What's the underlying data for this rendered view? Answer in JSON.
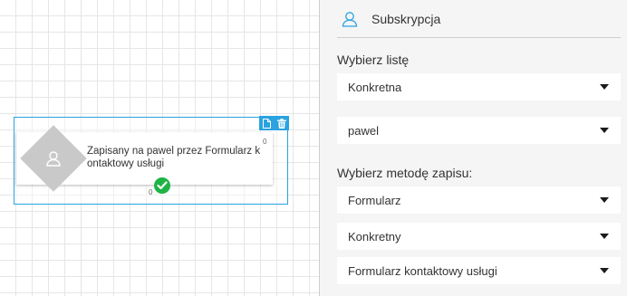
{
  "node": {
    "text": "Zapisany na pawel przez Formularz kontaktowy usługi",
    "port_top": "0",
    "port_bottom": "0",
    "toolbar_icons": [
      "file-icon",
      "trash-icon"
    ],
    "accent": "#2aa3e0",
    "success_color": "#1fb346"
  },
  "panel": {
    "title": "Subskrypcja",
    "list_label": "Wybierz listę",
    "list_type": "Konkretna",
    "list_value": "pawel",
    "method_label": "Wybierz metodę zapisu:",
    "method_type": "Formularz",
    "method_mode": "Konkretny",
    "method_value": "Formularz kontaktowy usługi"
  }
}
